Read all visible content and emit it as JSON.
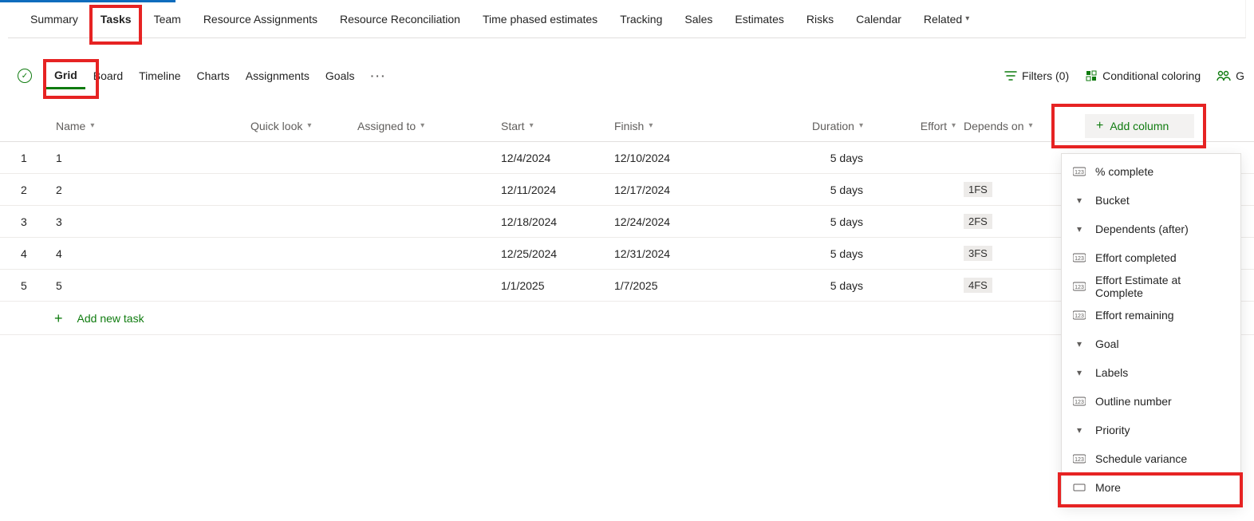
{
  "tabs": {
    "items": [
      {
        "label": "Summary"
      },
      {
        "label": "Tasks",
        "active": true
      },
      {
        "label": "Team"
      },
      {
        "label": "Resource Assignments"
      },
      {
        "label": "Resource Reconciliation"
      },
      {
        "label": "Time phased estimates"
      },
      {
        "label": "Tracking"
      },
      {
        "label": "Sales"
      },
      {
        "label": "Estimates"
      },
      {
        "label": "Risks"
      },
      {
        "label": "Calendar"
      },
      {
        "label": "Related",
        "chevron": true
      }
    ]
  },
  "views": {
    "items": [
      {
        "label": "Grid",
        "active": true
      },
      {
        "label": "Board"
      },
      {
        "label": "Timeline"
      },
      {
        "label": "Charts"
      },
      {
        "label": "Assignments"
      },
      {
        "label": "Goals"
      }
    ]
  },
  "toolbar_right": {
    "filters_label": "Filters (0)",
    "cond_color_label": "Conditional coloring",
    "group_label": "G"
  },
  "columns": {
    "name": "Name",
    "quick": "Quick look",
    "assigned": "Assigned to",
    "start": "Start",
    "finish": "Finish",
    "duration": "Duration",
    "effort": "Effort",
    "depends": "Depends on",
    "add_col": "Add column"
  },
  "rows": [
    {
      "n": "1",
      "name": "1",
      "start": "12/4/2024",
      "finish": "12/10/2024",
      "duration": "5 days",
      "dep": ""
    },
    {
      "n": "2",
      "name": "2",
      "start": "12/11/2024",
      "finish": "12/17/2024",
      "duration": "5 days",
      "dep": "1FS"
    },
    {
      "n": "3",
      "name": "3",
      "start": "12/18/2024",
      "finish": "12/24/2024",
      "duration": "5 days",
      "dep": "2FS"
    },
    {
      "n": "4",
      "name": "4",
      "start": "12/25/2024",
      "finish": "12/31/2024",
      "duration": "5 days",
      "dep": "3FS"
    },
    {
      "n": "5",
      "name": "5",
      "start": "1/1/2025",
      "finish": "1/7/2025",
      "duration": "5 days",
      "dep": "4FS"
    }
  ],
  "add_task_label": "Add new task",
  "dropdown": {
    "items": [
      {
        "icon": "num",
        "label": "% complete"
      },
      {
        "icon": "chev",
        "label": "Bucket"
      },
      {
        "icon": "chev",
        "label": "Dependents (after)"
      },
      {
        "icon": "num",
        "label": "Effort completed"
      },
      {
        "icon": "num",
        "label": "Effort Estimate at Complete"
      },
      {
        "icon": "num",
        "label": "Effort remaining"
      },
      {
        "icon": "chev",
        "label": "Goal"
      },
      {
        "icon": "chev",
        "label": "Labels"
      },
      {
        "icon": "num",
        "label": "Outline number"
      },
      {
        "icon": "chev",
        "label": "Priority"
      },
      {
        "icon": "num",
        "label": "Schedule variance"
      },
      {
        "icon": "rect",
        "label": "More"
      }
    ]
  }
}
